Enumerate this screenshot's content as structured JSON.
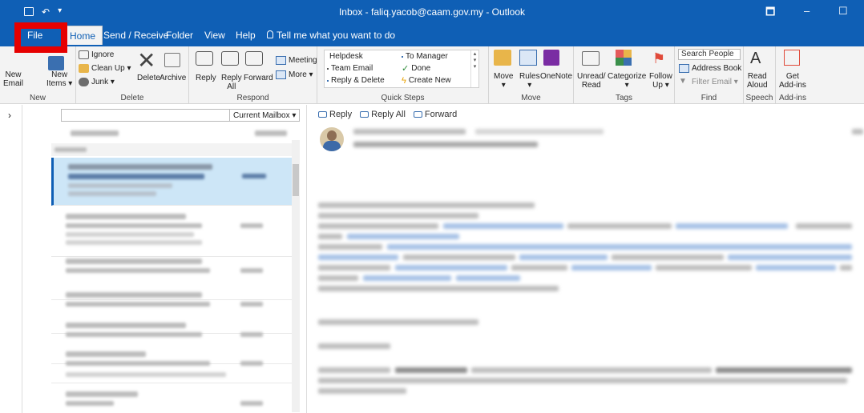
{
  "window": {
    "title": "Inbox - faliq.yacob@caam.gov.my  -  Outlook",
    "restore_glyph": "🗖",
    "minimize_glyph": "–",
    "maximize_glyph": "☐"
  },
  "qat": {
    "save_icon": "save-icon",
    "undo_glyph": "↶",
    "customize_glyph": "▾"
  },
  "tabs": [
    {
      "label": "File"
    },
    {
      "label": "Home"
    },
    {
      "label": "Send / Receive"
    },
    {
      "label": "Folder"
    },
    {
      "label": "View"
    },
    {
      "label": "Help"
    },
    {
      "label": "Tell me what you want to do"
    }
  ],
  "ribbon": {
    "new": {
      "new_email": "New\nEmail",
      "new_items": "New\nItems ▾",
      "group": "New"
    },
    "delete": {
      "ignore": "Ignore",
      "clean_up": "Clean Up ▾",
      "junk": "Junk ▾",
      "delete": "Delete",
      "archive": "Archive",
      "group": "Delete"
    },
    "respond": {
      "reply": "Reply",
      "reply_all": "Reply\nAll",
      "forward": "Forward",
      "meeting": "Meeting",
      "more": "More ▾",
      "group": "Respond"
    },
    "quick_steps": {
      "items": [
        "Helpdesk",
        "To Manager",
        "Team Email",
        "Done",
        "Reply & Delete",
        "Create New"
      ],
      "group": "Quick Steps"
    },
    "move": {
      "move": "Move\n▾",
      "rules": "Rules\n▾",
      "onenote": "OneNote",
      "group": "Move"
    },
    "tags": {
      "unread_read": "Unread/\nRead",
      "categorize": "Categorize\n▾",
      "follow_up": "Follow\nUp ▾",
      "group": "Tags"
    },
    "find": {
      "search_people": "Search People",
      "address_book": "Address Book",
      "filter_email": "Filter Email ▾",
      "group": "Find"
    },
    "speech": {
      "read_aloud": "Read\nAloud",
      "group": "Speech"
    },
    "addins": {
      "get_addins": "Get\nAdd-ins",
      "group": "Add-ins"
    }
  },
  "list": {
    "search_placeholder": "",
    "scope": "Current Mailbox",
    "scope_arrow": "▾",
    "expand": "›"
  },
  "reading": {
    "reply": "Reply",
    "reply_all": "Reply All",
    "forward": "Forward"
  },
  "colors": {
    "accent": "#0f5fb5",
    "highlight": "#e60000"
  }
}
